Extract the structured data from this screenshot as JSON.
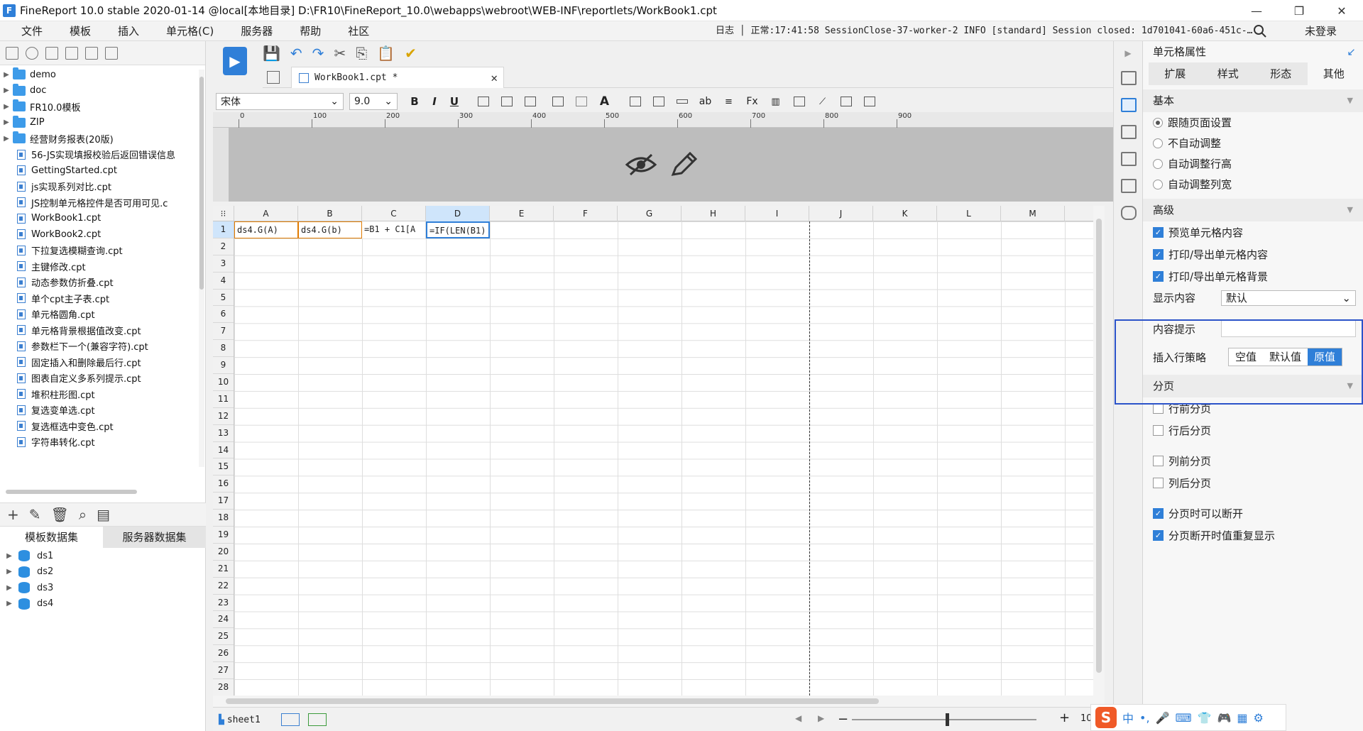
{
  "window": {
    "title": "FineReport 10.0 stable 2020-01-14 @local[本地目录]   D:\\FR10\\FineReport_10.0\\webapps\\webroot\\WEB-INF\\reportlets/WorkBook1.cpt",
    "minimize": "—",
    "restore": "❐",
    "close": "✕"
  },
  "menu": [
    "文件",
    "模板",
    "插入",
    "单元格(C)",
    "服务器",
    "帮助",
    "社区"
  ],
  "status": {
    "log": "日志 │ 正常:17:41:58 SessionClose-37-worker-2 INFO [standard] Session closed: 1d701041-60a6-451c-…",
    "login": "未登录"
  },
  "tree": {
    "folders": [
      "demo",
      "doc",
      "FR10.0模板",
      "ZIP",
      "经营财务报表(20版)"
    ],
    "files": [
      "56-JS实现填报校验后返回错误信息",
      "GettingStarted.cpt",
      "js实现系列对比.cpt",
      "JS控制单元格控件是否可用可见.c",
      "WorkBook1.cpt",
      "WorkBook2.cpt",
      "下拉复选模糊查询.cpt",
      "主键修改.cpt",
      "动态参数仿折叠.cpt",
      "单个cpt主子表.cpt",
      "单元格圆角.cpt",
      "单元格背景根据值改变.cpt",
      "参数栏下一个(兼容字符).cpt",
      "固定插入和删除最后行.cpt",
      "图表自定义多系列提示.cpt",
      "堆积柱形图.cpt",
      "复选变单选.cpt",
      "复选框选中变色.cpt",
      "字符串转化.cpt"
    ]
  },
  "datasets": {
    "tabs": [
      "模板数据集",
      "服务器数据集"
    ],
    "items": [
      "ds1",
      "ds2",
      "ds3",
      "ds4"
    ]
  },
  "editor": {
    "file_tab": "WorkBook1.cpt *",
    "font_name": "宋体",
    "font_size": "9.0",
    "bold": "B",
    "italic": "I",
    "underline": "U",
    "ruler_labels": [
      "0",
      "100",
      "200",
      "300",
      "400",
      "500",
      "600",
      "700",
      "800",
      "900"
    ],
    "columns": [
      "A",
      "B",
      "C",
      "D",
      "E",
      "F",
      "G",
      "H",
      "I",
      "J",
      "K",
      "L",
      "M"
    ],
    "row_count": 28,
    "cells": {
      "A1": "ds4.G(A)",
      "B1": "ds4.G(b)",
      "C1": "=B1 + C1[A",
      "D1": "=IF(LEN(B1)"
    },
    "sheet_name": "sheet1",
    "zoom": "100"
  },
  "props": {
    "title": "单元格属性",
    "tabs": [
      "扩展",
      "样式",
      "形态",
      "其他"
    ],
    "basic": {
      "header": "基本",
      "options": [
        "跟随页面设置",
        "不自动调整",
        "自动调整行高",
        "自动调整列宽"
      ]
    },
    "advanced": {
      "header": "高级",
      "checks": [
        "预览单元格内容",
        "打印/导出单元格内容",
        "打印/导出单元格背景"
      ],
      "display_label": "显示内容",
      "display_value": "默认",
      "tip_label": "内容提示",
      "tip_value": "",
      "insert_label": "插入行策略",
      "insert_options": [
        "空值",
        "默认值",
        "原值"
      ]
    },
    "paging": {
      "header": "分页",
      "checks": [
        "行前分页",
        "行后分页",
        "列前分页",
        "列后分页",
        "分页时可以断开",
        "分页断开时值重复显示"
      ]
    }
  },
  "ime": {
    "logo": "S",
    "mode": "中"
  }
}
